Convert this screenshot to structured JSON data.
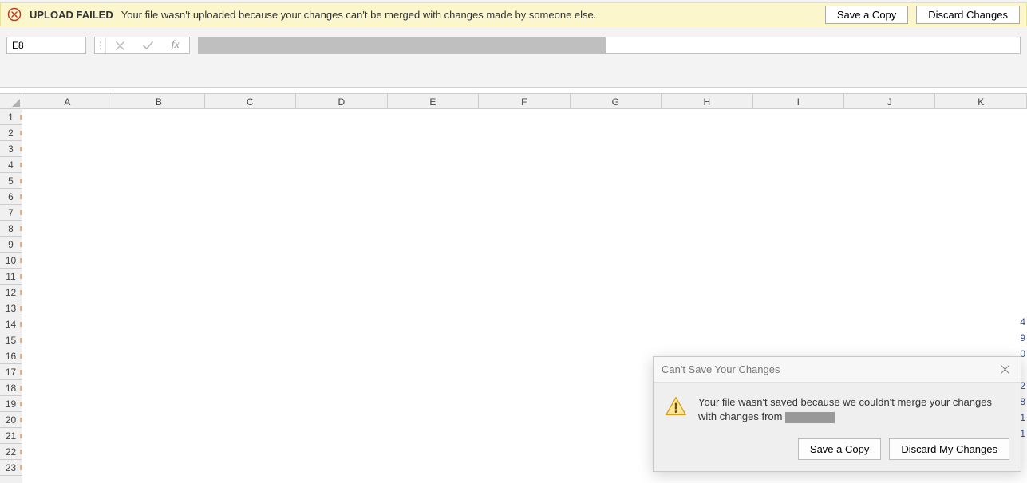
{
  "warning_bar": {
    "title": "UPLOAD FAILED",
    "message": "Your file wasn't uploaded because your changes can't be merged with changes made by someone else.",
    "save_copy_label": "Save a Copy",
    "discard_label": "Discard Changes"
  },
  "formula_bar": {
    "name_box_value": "E8"
  },
  "grid": {
    "columns": [
      "A",
      "B",
      "C",
      "D",
      "E",
      "F",
      "G",
      "H",
      "I",
      "J",
      "K"
    ],
    "rows": [
      "1",
      "2",
      "3",
      "4",
      "5",
      "6",
      "7",
      "8",
      "9",
      "10",
      "11",
      "12",
      "13",
      "14",
      "15",
      "16",
      "17",
      "18",
      "19",
      "20",
      "21",
      "22",
      "23"
    ]
  },
  "dialog": {
    "title": "Can't Save Your Changes",
    "message_a": "Your file wasn't saved because we couldn't merge your changes with changes from",
    "save_copy_label": "Save a Copy",
    "discard_label": "Discard My Changes"
  },
  "fragments": {
    "r14": "4",
    "r15": "9",
    "r16": "0",
    "r18": "2",
    "r19": "8",
    "r20": "1",
    "r21": "1"
  }
}
